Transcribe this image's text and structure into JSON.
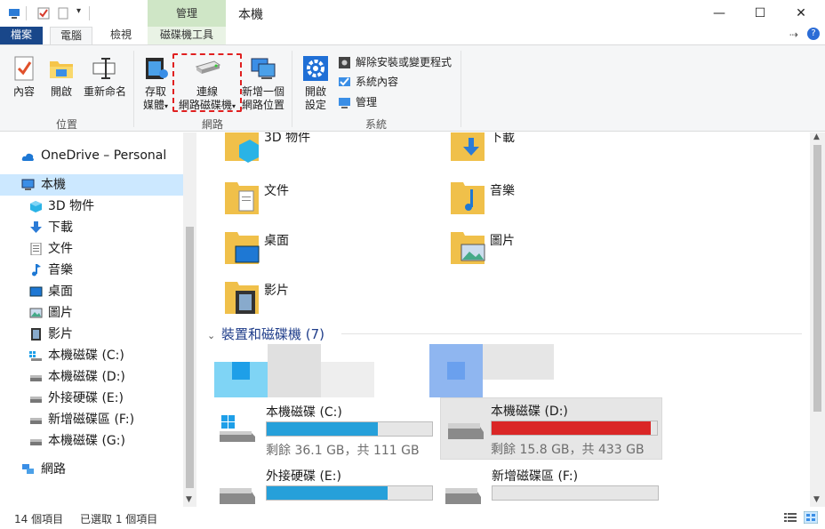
{
  "window": {
    "context_tab": "管理",
    "title": "本機",
    "controls": {
      "minimize": "—",
      "maximize": "☐",
      "close": "✕"
    }
  },
  "tabs": [
    "檔案",
    "電腦",
    "檢視",
    "磁碟機工具"
  ],
  "ribbon_right": {
    "pin": "⇢",
    "help": "?"
  },
  "ribbon": {
    "location": {
      "label": "位置",
      "properties": "內容",
      "open": "開啟",
      "rename": "重新命名"
    },
    "network": {
      "label": "網路",
      "access_media": [
        "存取",
        "媒體"
      ],
      "map_drive": [
        "連線",
        "網路磁碟機"
      ],
      "add_location": [
        "新增一個",
        "網路位置"
      ]
    },
    "system": {
      "label": "系統",
      "open_settings": [
        "開啟",
        "設定"
      ],
      "uninstall": "解除安裝或變更程式",
      "system_props": "系統內容",
      "manage": "管理"
    }
  },
  "nav": {
    "onedrive": "OneDrive – Personal",
    "this_pc": "本機",
    "items": [
      "3D 物件",
      "下載",
      "文件",
      "音樂",
      "桌面",
      "圖片",
      "影片",
      "本機磁碟 (C:)",
      "本機磁碟 (D:)",
      "外接硬碟 (E:)",
      "新增磁碟區 (F:)",
      "本機磁碟 (G:)"
    ],
    "network": "網路"
  },
  "folders": [
    "3D 物件",
    "下載",
    "文件",
    "音樂",
    "桌面",
    "圖片",
    "影片"
  ],
  "devices_header": "裝置和磁碟機 (7)",
  "drives": [
    {
      "name": "本機磁碟 (C:)",
      "free": "剩餘 36.1 GB，共 111 GB",
      "used_fraction": 0.67,
      "color": "#26a0da"
    },
    {
      "name": "本機磁碟 (D:)",
      "free": "剩餘 15.8 GB，共 433 GB",
      "used_fraction": 0.96,
      "color": "#da2626"
    },
    {
      "name": "外接硬碟 (E:)",
      "free": "",
      "used_fraction": 0.73,
      "color": "#26a0da"
    },
    {
      "name": "新增磁碟區 (F:)",
      "free": "",
      "used_fraction": 0.0,
      "color": "#26a0da"
    }
  ],
  "status": {
    "count": "14 個項目",
    "selected": "已選取 1 個項目"
  },
  "colors": {
    "file_tab": "#19478a",
    "context_green": "#cfe6c6",
    "selection": "#cce8ff",
    "bar_blue": "#26a0da",
    "bar_red": "#da2626",
    "dashed": "#e02020"
  }
}
